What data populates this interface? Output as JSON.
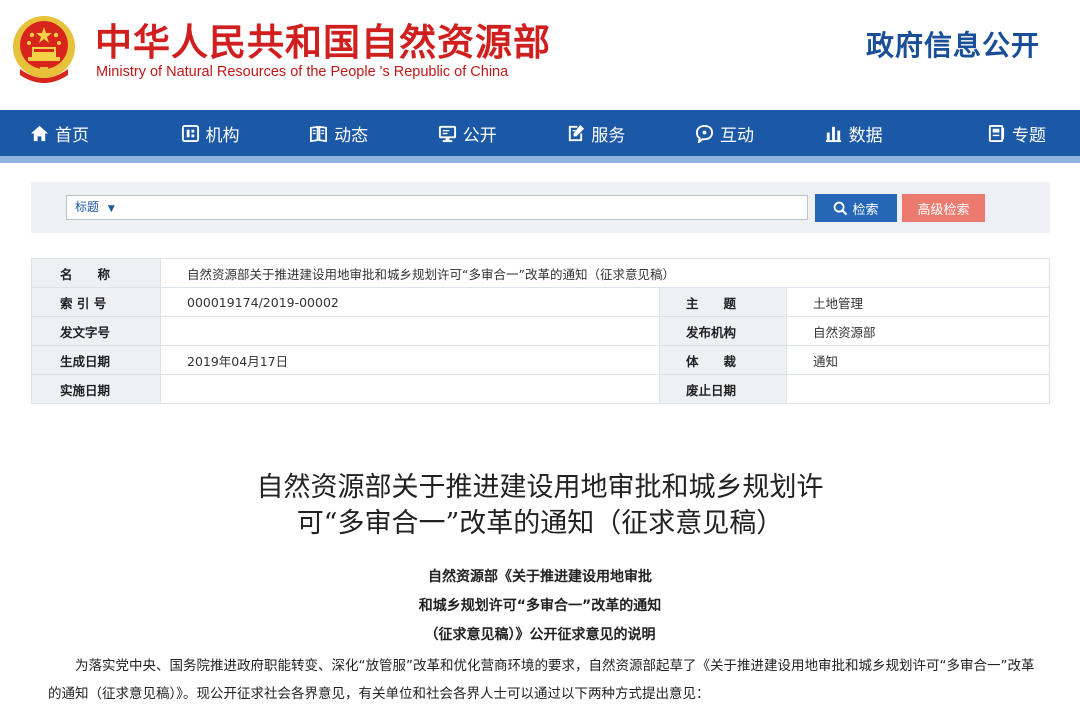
{
  "header": {
    "cn_name": "中华人民共和国自然资源部",
    "en_name": "Ministry of Natural Resources of the People 's Republic of China",
    "gov_open": "政府信息公开"
  },
  "nav": [
    {
      "label": "首页",
      "icon": "home-icon"
    },
    {
      "label": "机构",
      "icon": "org-icon"
    },
    {
      "label": "动态",
      "icon": "book-icon"
    },
    {
      "label": "公开",
      "icon": "monitor-icon"
    },
    {
      "label": "服务",
      "icon": "edit-doc-icon"
    },
    {
      "label": "互动",
      "icon": "chat-icon"
    },
    {
      "label": "数据",
      "icon": "bar-chart-icon"
    },
    {
      "label": "专题",
      "icon": "topic-icon"
    }
  ],
  "search": {
    "type_label": "标题",
    "value": "",
    "search_btn": "检索",
    "advanced_btn": "高级检索"
  },
  "meta": {
    "name_label": "名　　称",
    "name_value": "自然资源部关于推进建设用地审批和城乡规划许可“多审合一”改革的通知（征求意见稿）",
    "index_label": "索 引 号",
    "index_value": "000019174/2019-00002",
    "theme_label": "主　　题",
    "theme_value": "土地管理",
    "docno_label": "发文字号",
    "docno_value": "",
    "org_label": "发布机构",
    "org_value": "自然资源部",
    "date_label": "生成日期",
    "date_value": "2019年04月17日",
    "genre_label": "体　　裁",
    "genre_value": "通知",
    "impl_label": "实施日期",
    "impl_value": "",
    "abolish_label": "废止日期",
    "abolish_value": ""
  },
  "article": {
    "title_line1": "自然资源部关于推进建设用地审批和城乡规划许",
    "title_line2": "可“多审合一”改革的通知（征求意见稿）",
    "sub_line1": "自然资源部《关于推进建设用地审批",
    "sub_line2": "和城乡规划许可“多审合一”改革的通知",
    "sub_line3": "（征求意见稿）》公开征求意见的说明",
    "paragraph": "为落实党中央、国务院推进政府职能转变、深化“放管服”改革和优化营商环境的要求，自然资源部起草了《关于推进建设用地审批和城乡规划许可“多审合一”改革的通知（征求意见稿）》。现公开征求社会各界意见，有关单位和社会各界人士可以通过以下两种方式提出意见："
  },
  "colors": {
    "brand_red": "#d01f1f",
    "nav_blue": "#1b58a6",
    "search_blue": "#2566b7",
    "advanced_red": "#ed7a6f"
  }
}
